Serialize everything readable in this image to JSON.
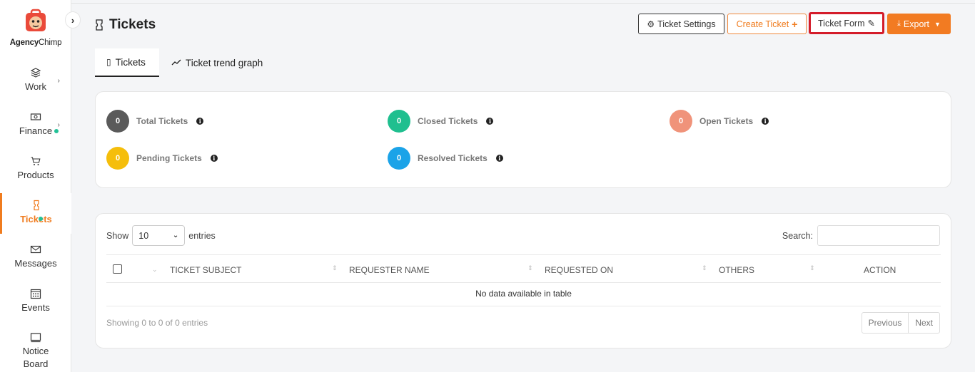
{
  "brand": {
    "name_bold": "Agency",
    "name_regular": "Chimp"
  },
  "sidebar": {
    "items": [
      {
        "label": "Work"
      },
      {
        "label": "Finance"
      },
      {
        "label": "Products"
      },
      {
        "label": "Tickets"
      },
      {
        "label": "Messages"
      },
      {
        "label": "Events"
      },
      {
        "label": "Notice Board"
      }
    ]
  },
  "header": {
    "title": "Tickets",
    "buttons": {
      "settings": "Ticket Settings",
      "create": "Create Ticket",
      "form": "Ticket Form",
      "export": "Export"
    }
  },
  "tabs": [
    {
      "label": "Tickets"
    },
    {
      "label": "Ticket trend graph"
    }
  ],
  "stats": [
    {
      "label": "Total Tickets",
      "value": "0",
      "color": "#5a5a5a"
    },
    {
      "label": "Closed Tickets",
      "value": "0",
      "color": "#1fbf8f"
    },
    {
      "label": "Open Tickets",
      "value": "0",
      "color": "#f0937a"
    },
    {
      "label": "Pending Tickets",
      "value": "0",
      "color": "#f5be0b"
    },
    {
      "label": "Resolved Tickets",
      "value": "0",
      "color": "#1ba3e8"
    }
  ],
  "table": {
    "show_label": "Show",
    "page_size": "10",
    "entries_label": "entries",
    "search_label": "Search:",
    "columns": [
      "TICKET SUBJECT",
      "REQUESTER NAME",
      "REQUESTED ON",
      "OTHERS",
      "ACTION"
    ],
    "empty_message": "No data available in table",
    "info": "Showing 0 to 0 of 0 entries",
    "previous": "Previous",
    "next": "Next"
  },
  "colors": {
    "accent": "#f27b22",
    "highlight": "#d41c2a"
  }
}
